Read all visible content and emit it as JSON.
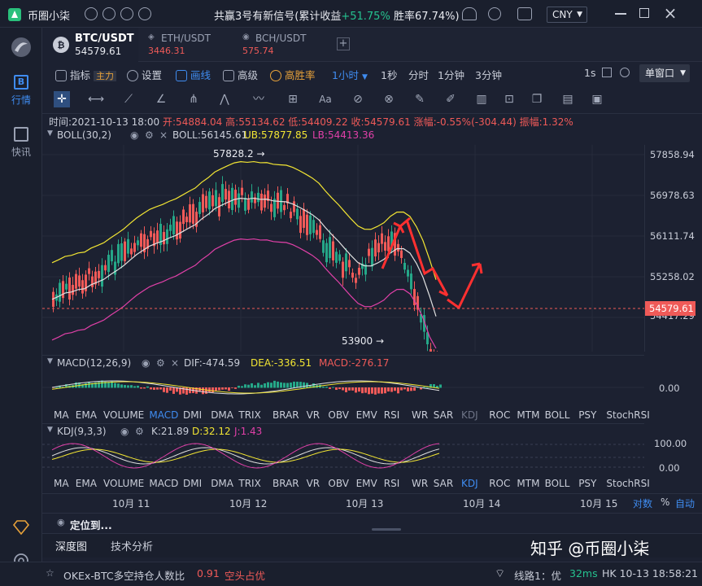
{
  "app": {
    "name": "币圈小柒",
    "banner_prefix": "共赢3号有新信号(累计收益",
    "banner_gain": "+51.75%",
    "banner_suffix": "胜率67.74%)",
    "currency": "CNY"
  },
  "sidebar": {
    "items": [
      {
        "label": "行情"
      },
      {
        "label": "快讯"
      }
    ]
  },
  "tabs": [
    {
      "pair": "BTC/USDT",
      "price": "54579.61"
    },
    {
      "pair": "ETH/USDT",
      "price": "3446.31"
    },
    {
      "pair": "BCH/USDT",
      "price": "575.74"
    }
  ],
  "toolbar": {
    "indicators": "指标",
    "main": "主力",
    "settings": "设置",
    "draw": "画线",
    "advanced": "高级",
    "winrate": "高胜率",
    "intervals": [
      "1小时",
      "1秒",
      "分时",
      "1分钟",
      "3分钟"
    ],
    "right_interval": "1s",
    "window_mode": "单窗口"
  },
  "ohlc": {
    "time": "时间:2021-10-13 18:00",
    "open": "开:54884.04",
    "high": "高:55134.62",
    "low": "低:54409.22",
    "close": "收:54579.61",
    "change": "涨幅:-0.55%(-304.44)",
    "amplitude": "振幅:1.32%"
  },
  "boll": {
    "name": "BOLL(30,2)",
    "mid": "BOLL:56145.61",
    "ub": "UB:57877.85",
    "lb": "LB:54413.36"
  },
  "price_axis": [
    "57858.94",
    "56978.63",
    "56111.74",
    "55258.02",
    "54417.29"
  ],
  "current_price": "54579.61",
  "annotations": {
    "high": "57828.2 →",
    "low": "53900 →"
  },
  "macd": {
    "name": "MACD(12,26,9)",
    "dif": "DIF:-474.59",
    "dea": "DEA:-336.51",
    "macd": "MACD:-276.17",
    "axis": "0.00"
  },
  "indicator_tabs": [
    "MA",
    "EMA",
    "VOLUME",
    "MACD",
    "DMI",
    "DMA",
    "TRIX",
    "BRAR",
    "VR",
    "OBV",
    "EMV",
    "RSI",
    "WR",
    "SAR",
    "KDJ",
    "ROC",
    "MTM",
    "BOLL",
    "PSY",
    "StochRSI"
  ],
  "kdj": {
    "name": "KDJ(9,3,3)",
    "k": "K:21.89",
    "d": "D:32.12",
    "j": "J:1.43",
    "axis_top": "100.00",
    "axis_bottom": "0.00"
  },
  "date_axis": [
    "10月 11",
    "10月 12",
    "10月 13",
    "10月 14",
    "10月 15"
  ],
  "date_controls": {
    "log": "对数",
    "pct": "%",
    "auto": "自动"
  },
  "locate": "定位到...",
  "bottom_tabs": [
    "深度图",
    "技术分析"
  ],
  "status": {
    "ratio_label": "OKEx-BTC多空持仓人数比",
    "ratio_value": "0.91",
    "ratio_text": "空头占优",
    "line": "线路1：优",
    "latency": "32ms",
    "time": "HK 10-13 18:58:21"
  },
  "watermark": "知乎 @币圈小柒",
  "colors": {
    "up": "#25a788",
    "down": "#ef5a58",
    "ub": "#f2e533",
    "mid": "#e0e0e0",
    "lb": "#e040a8",
    "accent": "#3f8cf0"
  }
}
